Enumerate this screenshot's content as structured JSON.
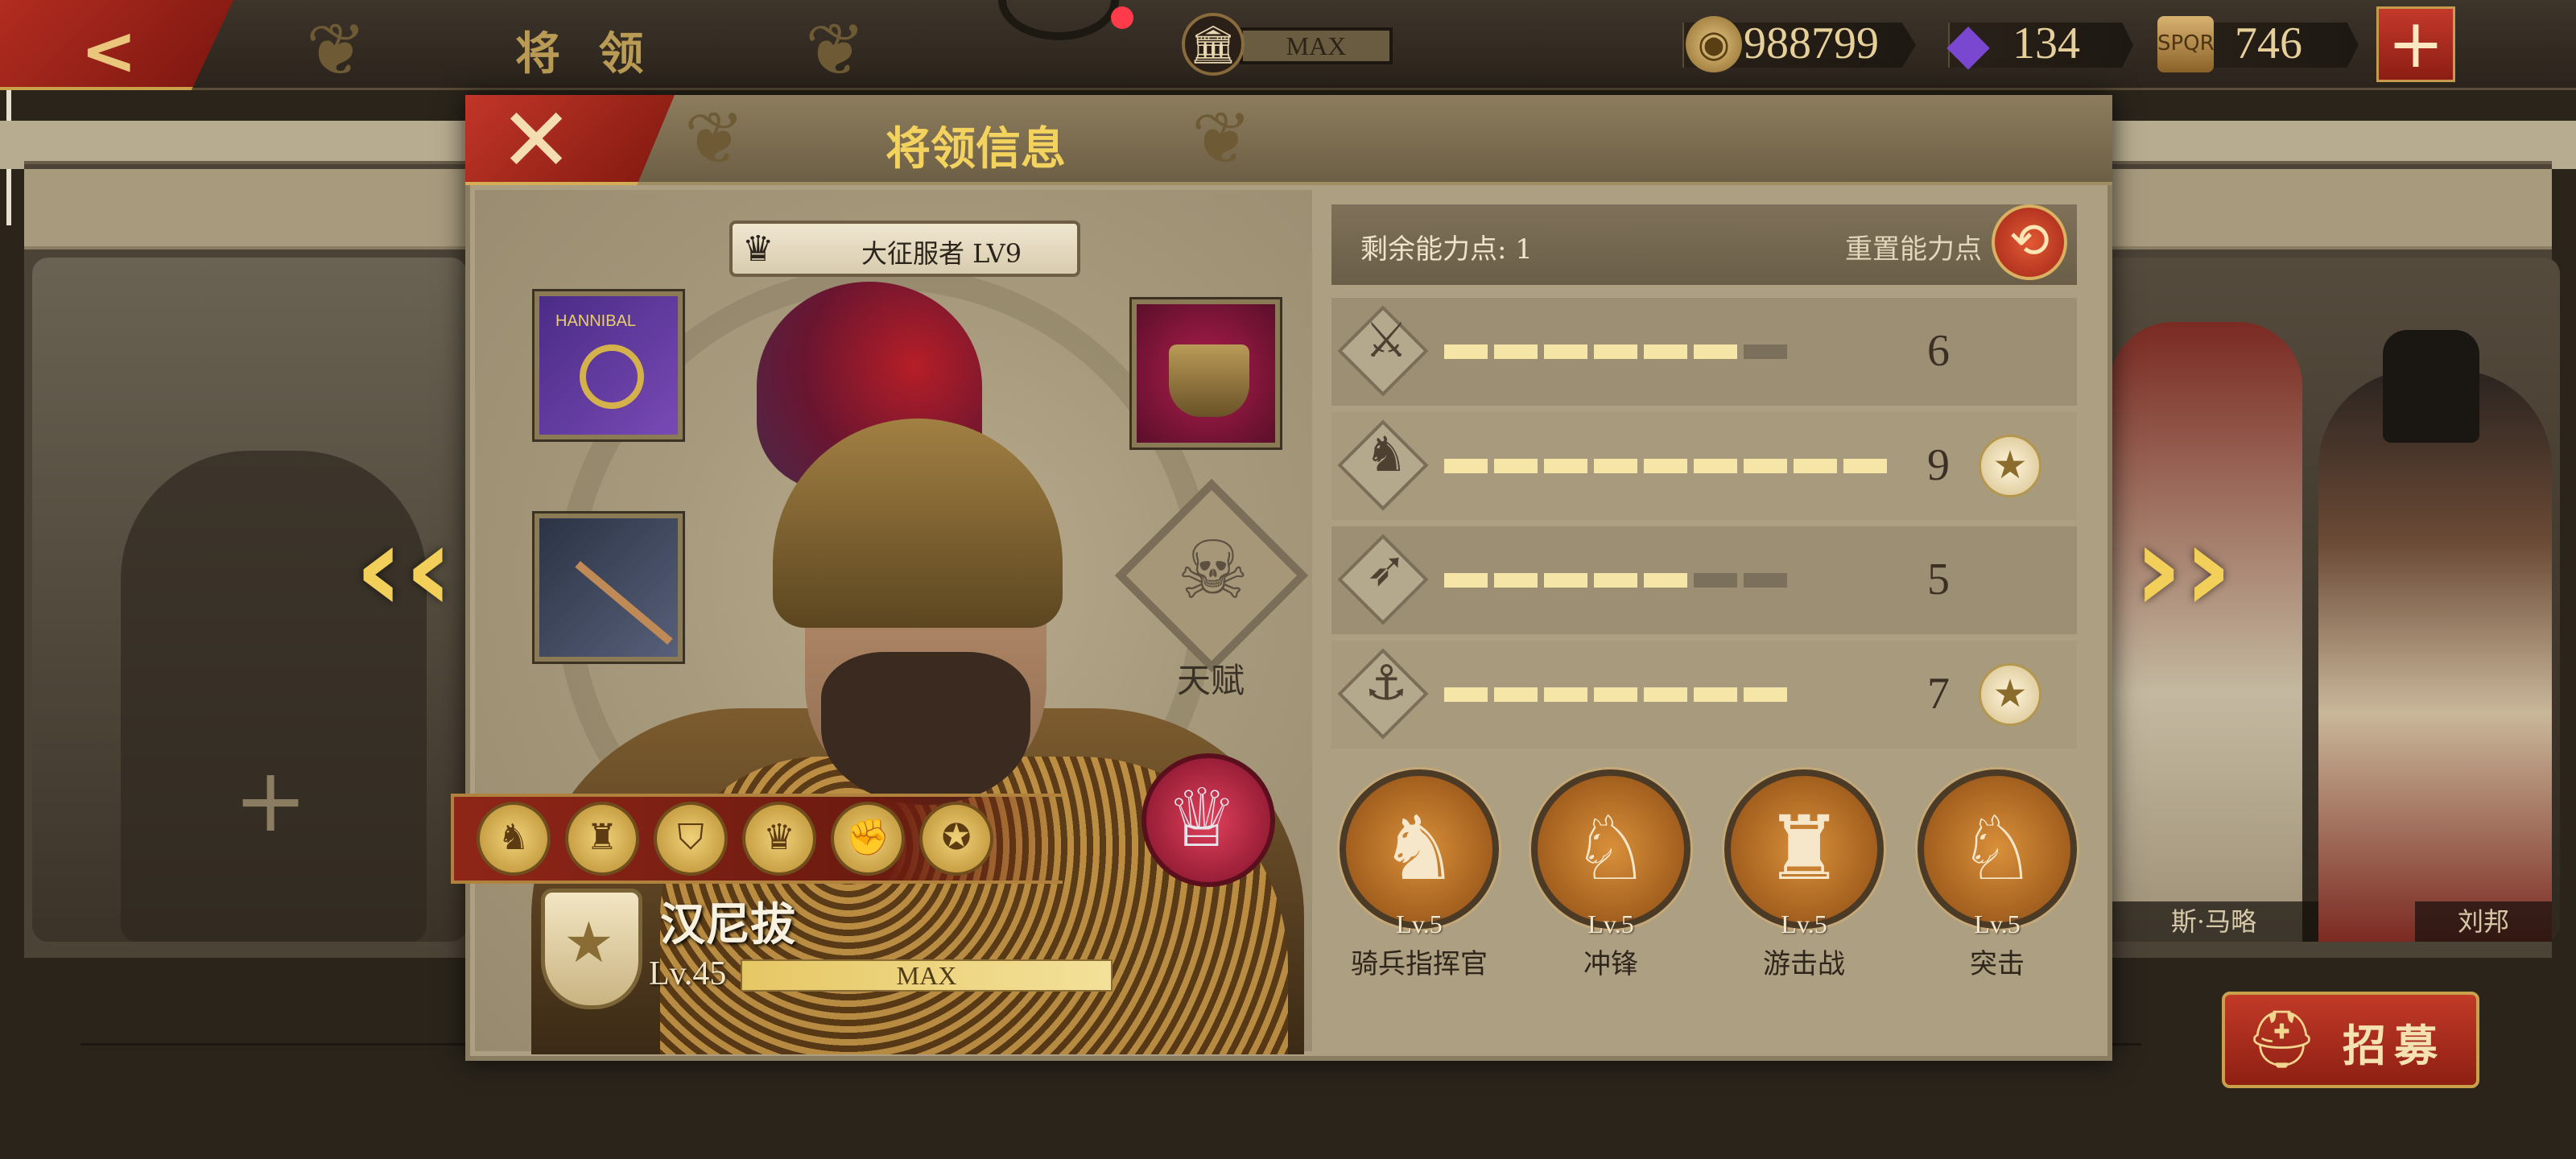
{
  "topbar": {
    "title": "将 领",
    "back_icon": "back-arrow",
    "museum_level": "MAX",
    "resources": [
      {
        "name": "coin",
        "value": "988799",
        "color": "#c9a35a"
      },
      {
        "name": "gem",
        "value": "134",
        "color": "#6a3fc2"
      },
      {
        "name": "spqr-token",
        "value": "746",
        "color": "#c9a35a"
      }
    ],
    "add_label": "+"
  },
  "background": {
    "left_slot_plus": "+",
    "right_general_1_name": "斯·马略",
    "right_general_2_name": "刘邦",
    "recruit_label": "招募",
    "prev_arrow": "‹‹",
    "next_arrow": "››"
  },
  "modal": {
    "title": "将领信息",
    "close_icon": "✕",
    "rank": "大征服者 LV9",
    "banner_text": "HANNIBAL",
    "talent_label": "天赋",
    "hero_name": "汉尼拔",
    "hero_level": "Lv.45",
    "exp_label": "MAX",
    "exp_progress": 1.0
  },
  "stats": {
    "remaining_points_label": "剩余能力点: 1",
    "reset_label": "重置能力点",
    "rows": [
      {
        "icon": "sword-icon",
        "glyph": "⚔",
        "value": "6",
        "filled": 6,
        "total": 7,
        "starred": false
      },
      {
        "icon": "horse-icon",
        "glyph": "♞",
        "value": "9",
        "filled": 9,
        "total": 9,
        "starred": true
      },
      {
        "icon": "bow-icon",
        "glyph": "➶",
        "value": "5",
        "filled": 5,
        "total": 7,
        "starred": false
      },
      {
        "icon": "anchor-icon",
        "glyph": "⚓",
        "value": "7",
        "filled": 7,
        "total": 7,
        "starred": true
      }
    ],
    "colors": {
      "filled": "#f5e6a8",
      "empty": "#7b705c"
    }
  },
  "skills": [
    {
      "name": "骑兵指挥官",
      "level": "Lv.5",
      "glyph": "♞"
    },
    {
      "name": "冲锋",
      "level": "Lv.5",
      "glyph": "♘"
    },
    {
      "name": "游击战",
      "level": "Lv.5",
      "glyph": "♜"
    },
    {
      "name": "突击",
      "level": "Lv.5",
      "glyph": "♘"
    }
  ],
  "medals": [
    "♞",
    "♜",
    "⛉",
    "♛",
    "✊",
    "✪"
  ]
}
